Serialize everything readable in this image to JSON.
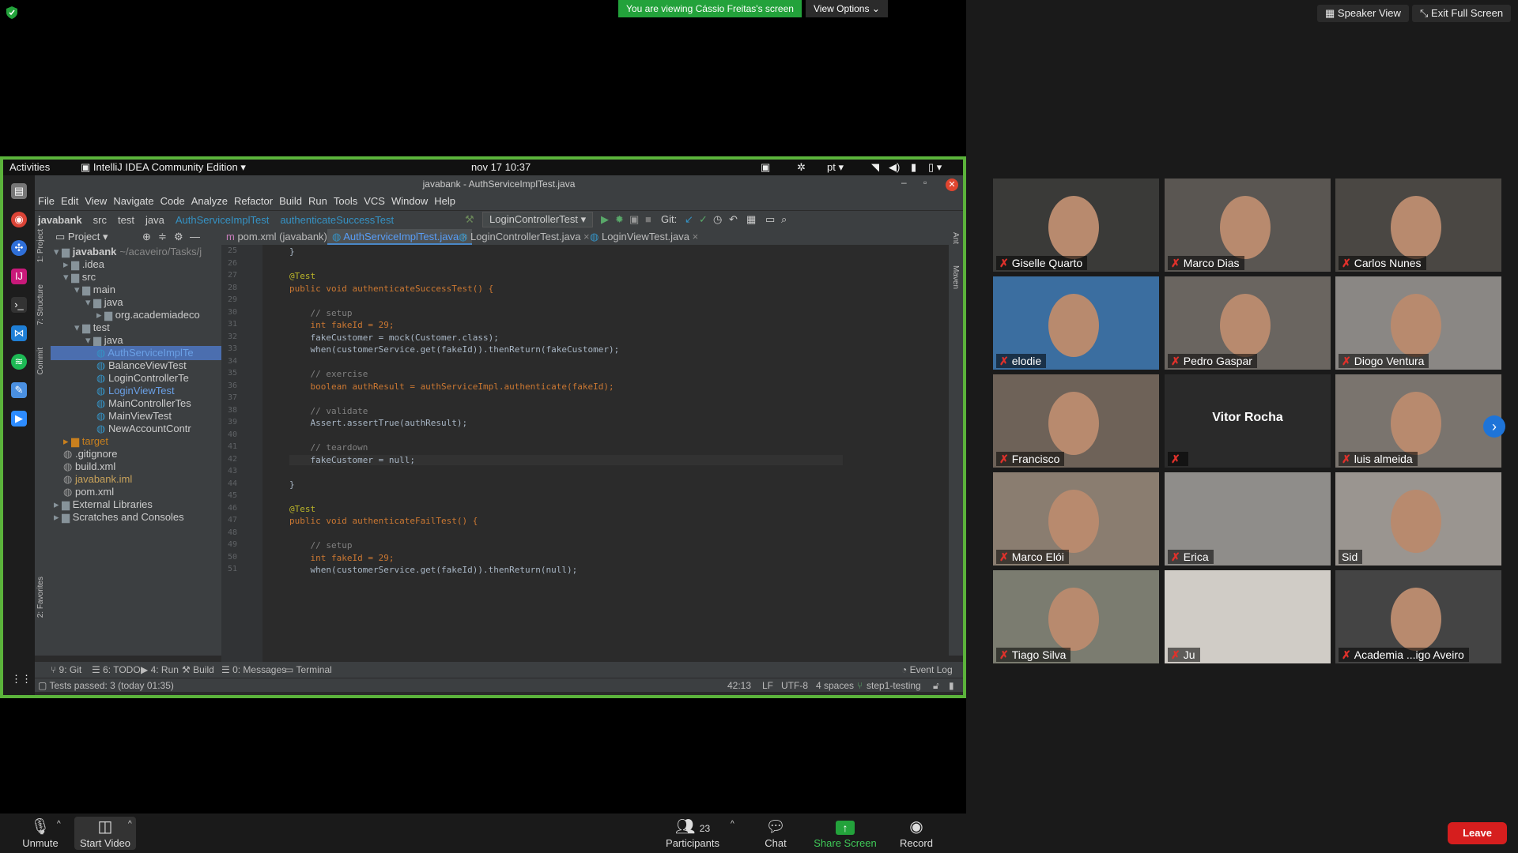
{
  "zoom": {
    "viewing_banner": "You are viewing Cássio Freitas's screen",
    "view_options": "View Options",
    "speaker_view": "Speaker View",
    "exit_full_screen": "Exit Full Screen",
    "toolbar": {
      "unmute": "Unmute",
      "start_video": "Start Video",
      "participants": "Participants",
      "participants_count": "23",
      "chat": "Chat",
      "share_screen": "Share Screen",
      "record": "Record",
      "leave": "Leave"
    },
    "participants": [
      {
        "name": "Giselle Quarto",
        "muted": true
      },
      {
        "name": "Marco Dias",
        "muted": true
      },
      {
        "name": "Carlos Nunes",
        "muted": true
      },
      {
        "name": "elodie",
        "muted": true
      },
      {
        "name": "Pedro Gaspar",
        "muted": true
      },
      {
        "name": "Diogo Ventura",
        "muted": true
      },
      {
        "name": "Francisco",
        "muted": true
      },
      {
        "name": "Vitor Rocha",
        "muted": true
      },
      {
        "name": "luis almeida",
        "muted": true
      },
      {
        "name": "Marco Elói",
        "muted": true
      },
      {
        "name": "Erica",
        "muted": true
      },
      {
        "name": "Sid",
        "muted": false
      },
      {
        "name": "Tiago Silva",
        "muted": true
      },
      {
        "name": "Ju",
        "muted": true
      },
      {
        "name": "Academia ...igo Aveiro",
        "muted": true
      }
    ]
  },
  "desktop": {
    "activities": "Activities",
    "app_name": "IntelliJ IDEA Community Edition",
    "clock": "nov 17  10:37",
    "lang": "pt"
  },
  "ide": {
    "window_title": "javabank - AuthServiceImplTest.java",
    "menu": [
      "File",
      "Edit",
      "View",
      "Navigate",
      "Code",
      "Analyze",
      "Refactor",
      "Build",
      "Run",
      "Tools",
      "VCS",
      "Window",
      "Help"
    ],
    "breadcrumb": [
      "javabank",
      "src",
      "test",
      "java",
      "AuthServiceImplTest",
      "authenticateSuccessTest"
    ],
    "run_config": "LoginControllerTest",
    "git_label": "Git:",
    "tabs": [
      "pom.xml (javabank)",
      "AuthServiceImplTest.java",
      "LoginControllerTest.java",
      "LoginViewTest.java"
    ],
    "project_header": "Project",
    "tree": [
      {
        "label": "javabank",
        "extra": "~/acaveiro/Tasks/j",
        "depth": 0
      },
      {
        "label": ".idea",
        "depth": 1
      },
      {
        "label": "src",
        "depth": 1
      },
      {
        "label": "main",
        "depth": 2
      },
      {
        "label": "java",
        "depth": 3
      },
      {
        "label": "org.academiadeco",
        "depth": 4
      },
      {
        "label": "test",
        "depth": 2
      },
      {
        "label": "java",
        "depth": 3
      },
      {
        "label": "AuthServiceImplTe",
        "depth": 4
      },
      {
        "label": "BalanceViewTest",
        "depth": 4
      },
      {
        "label": "LoginControllerTe",
        "depth": 4
      },
      {
        "label": "LoginViewTest",
        "depth": 4
      },
      {
        "label": "MainControllerTes",
        "depth": 4
      },
      {
        "label": "MainViewTest",
        "depth": 4
      },
      {
        "label": "NewAccountContr",
        "depth": 4
      },
      {
        "label": "target",
        "depth": 1
      },
      {
        "label": ".gitignore",
        "depth": 1
      },
      {
        "label": "build.xml",
        "depth": 1
      },
      {
        "label": "javabank.iml",
        "depth": 1
      },
      {
        "label": "pom.xml",
        "depth": 1
      },
      {
        "label": "External Libraries",
        "depth": 0
      },
      {
        "label": "Scratches and Consoles",
        "depth": 0
      }
    ],
    "code": [
      {
        "n": "25",
        "t": "}"
      },
      {
        "n": "26",
        "t": ""
      },
      {
        "n": "27",
        "t": "@Test"
      },
      {
        "n": "28",
        "t": "public void authenticateSuccessTest() {"
      },
      {
        "n": "29",
        "t": ""
      },
      {
        "n": "30",
        "t": "    // setup"
      },
      {
        "n": "31",
        "t": "    int fakeId = 29;"
      },
      {
        "n": "32",
        "t": "    fakeCustomer = mock(Customer.class);"
      },
      {
        "n": "33",
        "t": "    when(customerService.get(fakeId)).thenReturn(fakeCustomer);"
      },
      {
        "n": "34",
        "t": ""
      },
      {
        "n": "35",
        "t": "    // exercise"
      },
      {
        "n": "36",
        "t": "    boolean authResult = authServiceImpl.authenticate(fakeId);"
      },
      {
        "n": "37",
        "t": ""
      },
      {
        "n": "38",
        "t": "    // validate"
      },
      {
        "n": "39",
        "t": "    Assert.assertTrue(authResult);"
      },
      {
        "n": "40",
        "t": ""
      },
      {
        "n": "41",
        "t": "    // teardown"
      },
      {
        "n": "42",
        "t": "    fakeCustomer = null;"
      },
      {
        "n": "43",
        "t": ""
      },
      {
        "n": "44",
        "t": "}"
      },
      {
        "n": "45",
        "t": ""
      },
      {
        "n": "46",
        "t": "@Test"
      },
      {
        "n": "47",
        "t": "public void authenticateFailTest() {"
      },
      {
        "n": "48",
        "t": ""
      },
      {
        "n": "49",
        "t": "    // setup"
      },
      {
        "n": "50",
        "t": "    int fakeId = 29;"
      },
      {
        "n": "51",
        "t": "    when(customerService.get(fakeId)).thenReturn(null);"
      }
    ],
    "bottom_tools": [
      "9: Git",
      "6: TODO",
      "4: Run",
      "Build",
      "0: Messages",
      "Terminal"
    ],
    "event_log": "Event Log",
    "status_text": "Tests passed: 3 (today 01:35)",
    "status_right": [
      "42:13",
      "LF",
      "UTF-8",
      "4 spaces",
      "step1-testing"
    ],
    "side_left": [
      "1: Project",
      "7: Structure",
      "Commit",
      "2: Favorites"
    ],
    "side_right": [
      "Ant",
      "Maven"
    ]
  },
  "colors": {
    "zoom_green": "#23a23b",
    "share_border": "#5bb33b",
    "leave_red": "#d61e1e",
    "ide_bg": "#2b2b2b"
  }
}
